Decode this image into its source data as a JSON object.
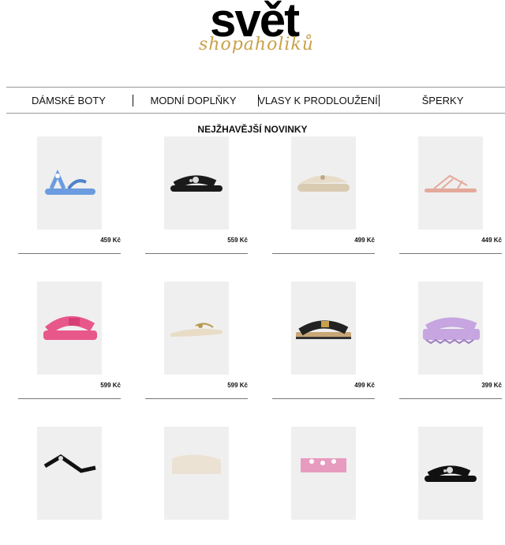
{
  "logo": {
    "main": "svět",
    "script": "shopaholiků"
  },
  "nav": [
    {
      "label": "DÁMSKÉ BOTY"
    },
    {
      "label": "MODNÍ DOPLŇKY"
    },
    {
      "label": "VLASY K PRODLOUŽENÍ"
    },
    {
      "label": "ŠPERKY"
    }
  ],
  "section": {
    "title": "NEJŽHAVĚJŠÍ NOVINKY"
  },
  "products": [
    {
      "price": "459 Kč",
      "item": "blue-sandal",
      "color": "#6b9ce0"
    },
    {
      "price": "559 Kč",
      "item": "black-slide",
      "color": "#1a1a1a"
    },
    {
      "price": "499 Kč",
      "item": "beige-clog",
      "color": "#e8dcc8"
    },
    {
      "price": "449 Kč",
      "item": "pink-strappy-sandal",
      "color": "#e4a99b"
    },
    {
      "price": "599 Kč",
      "item": "pink-platform-slide",
      "color": "#e8578a"
    },
    {
      "price": "599 Kč",
      "item": "cream-flat-mule",
      "color": "#e9dcc6"
    },
    {
      "price": "499 Kč",
      "item": "black-espadrille-slide",
      "color": "#222222"
    },
    {
      "price": "399 Kč",
      "item": "lilac-platform-slide",
      "color": "#c6a5e0"
    },
    {
      "price": "",
      "item": "black-sandal",
      "color": "#111111"
    },
    {
      "price": "",
      "item": "cream-slide",
      "color": "#ebe2d4"
    },
    {
      "price": "",
      "item": "pink-slide",
      "color": "#e79bbf"
    },
    {
      "price": "",
      "item": "black-slide",
      "color": "#111111"
    }
  ]
}
